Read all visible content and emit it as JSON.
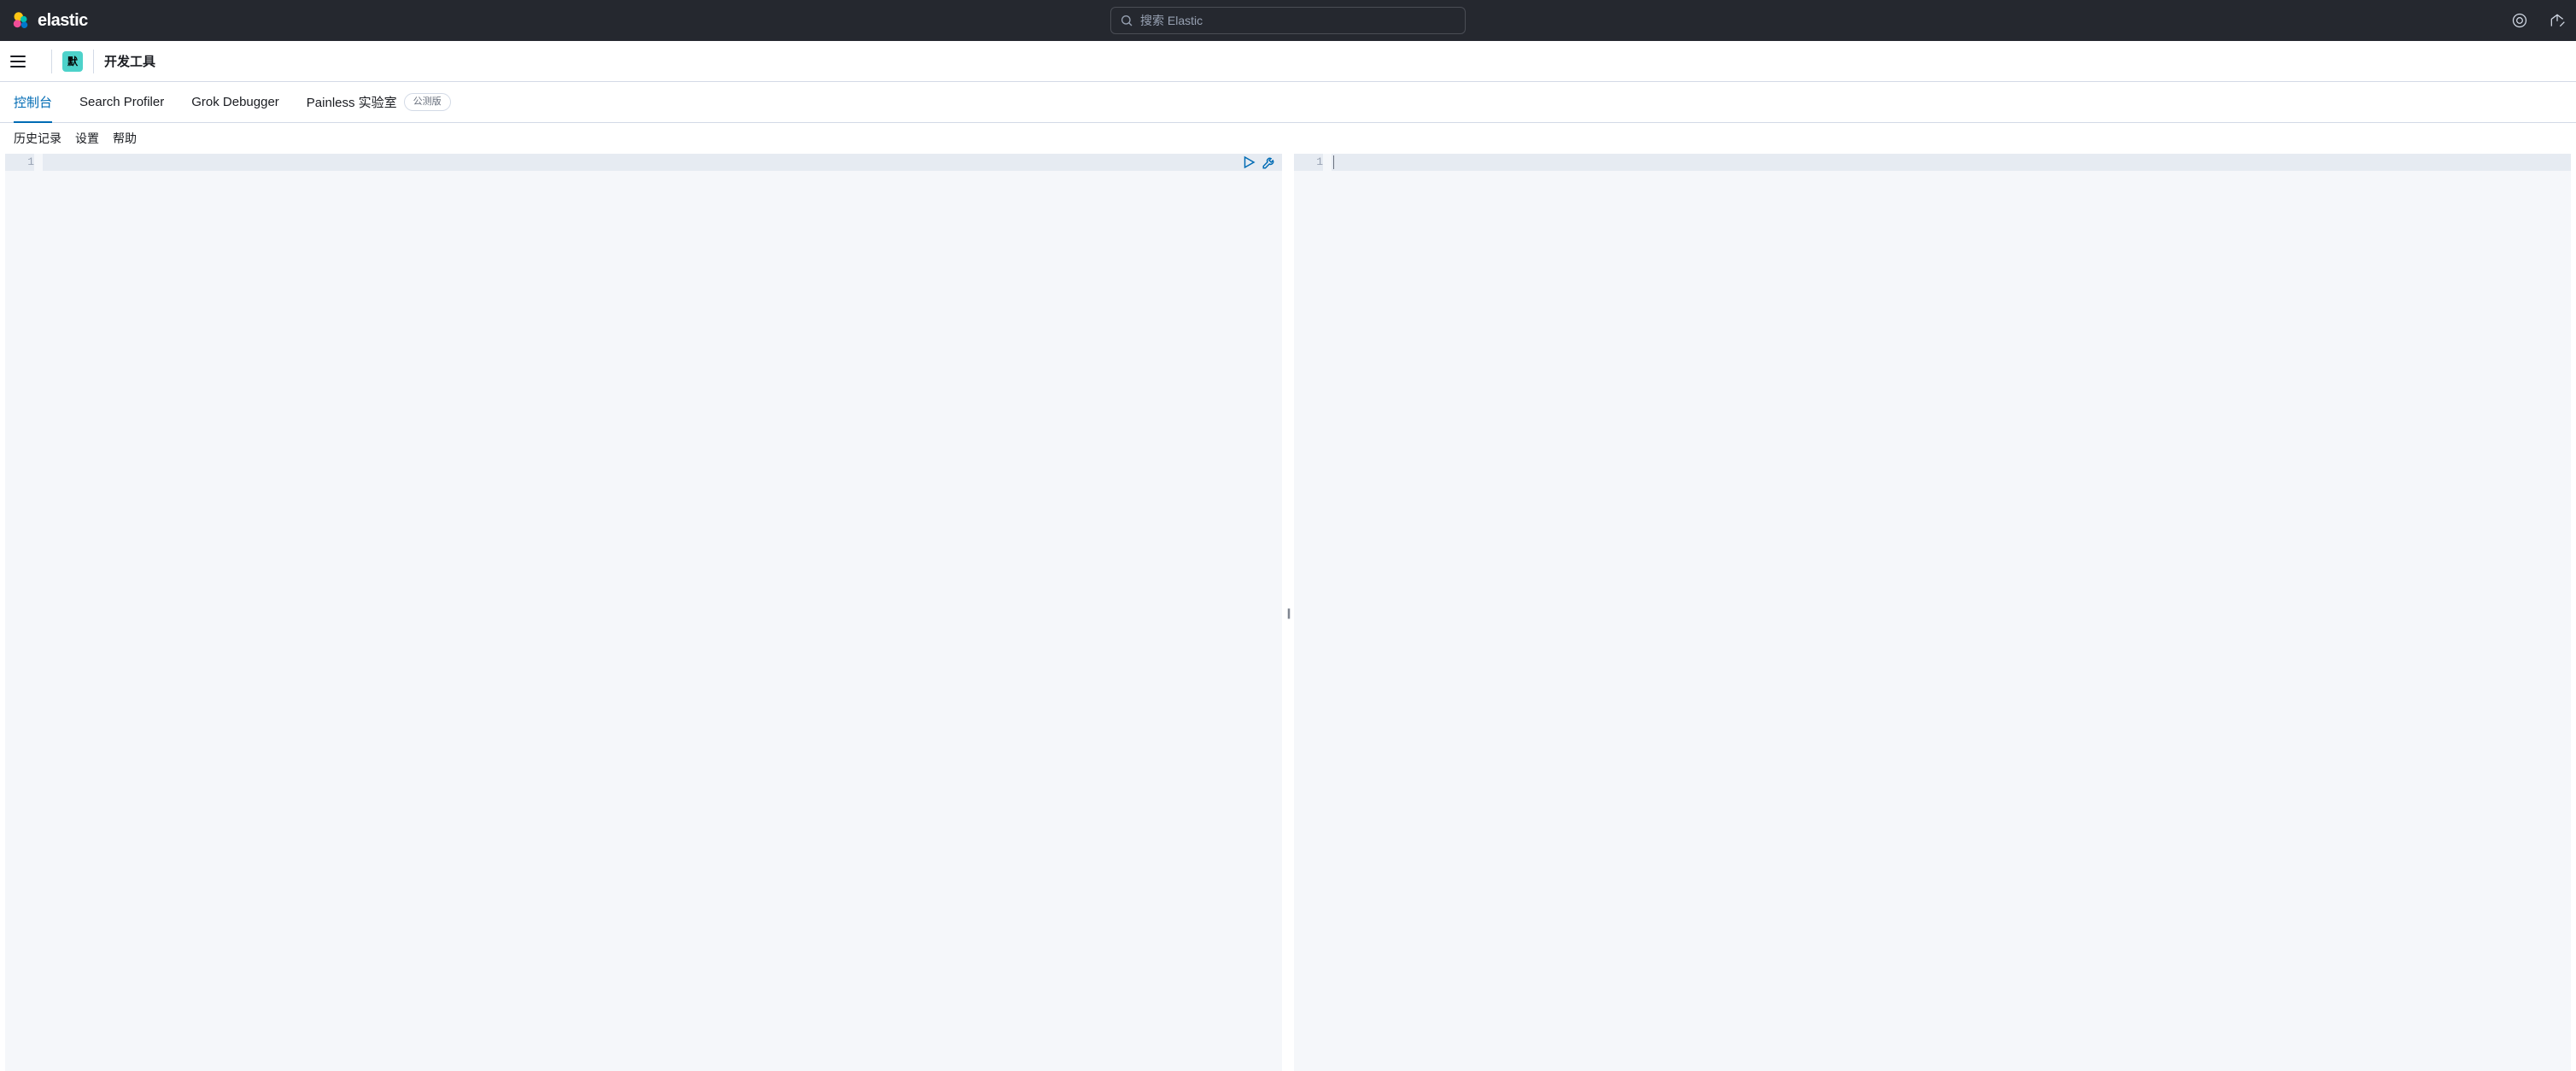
{
  "header": {
    "brand": "elastic",
    "search_placeholder": "搜索 Elastic"
  },
  "subheader": {
    "space_badge": "默",
    "breadcrumb": "开发工具"
  },
  "tabs": [
    {
      "label": "控制台",
      "active": true
    },
    {
      "label": "Search Profiler",
      "active": false
    },
    {
      "label": "Grok Debugger",
      "active": false
    },
    {
      "label": "Painless 实验室",
      "active": false,
      "badge": "公测版"
    }
  ],
  "console_toolbar": {
    "history": "历史记录",
    "settings": "设置",
    "help": "帮助"
  },
  "editor": {
    "left_pane": {
      "line_numbers": [
        "1"
      ]
    },
    "right_pane": {
      "line_numbers": [
        "1"
      ]
    }
  }
}
